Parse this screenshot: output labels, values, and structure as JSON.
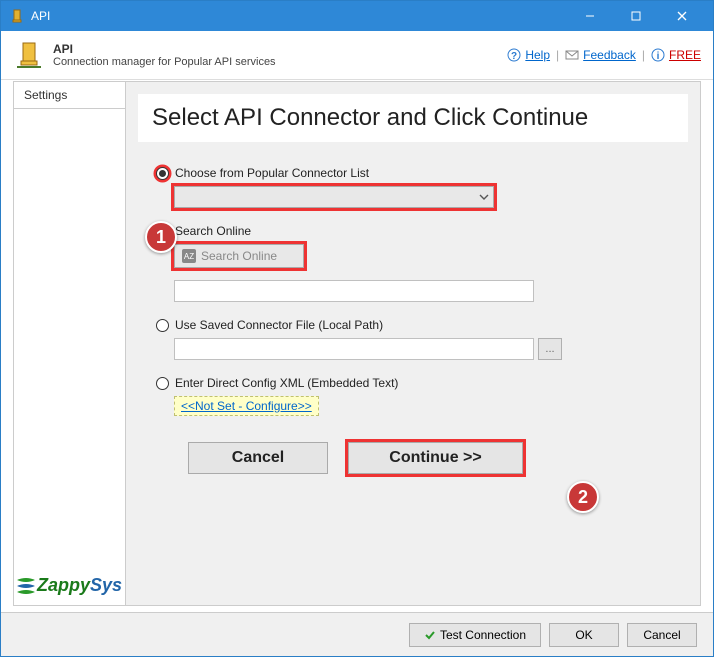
{
  "titlebar": {
    "title": "API"
  },
  "header": {
    "title": "API",
    "subtitle": "Connection manager for Popular API services",
    "links": {
      "help": "Help",
      "feedback": "Feedback",
      "free": "FREE"
    }
  },
  "sidebar": {
    "tab_settings": "Settings"
  },
  "main": {
    "title": "Select API Connector and Click Continue",
    "option_popular": "Choose from Popular Connector List",
    "option_search": "Search Online",
    "search_button_label": "Search Online",
    "option_saved": "Use Saved Connector File (Local Path)",
    "browse_label": "...",
    "option_xml": "Enter Direct Config XML (Embedded Text)",
    "config_link": "<<Not Set - Configure>>",
    "cancel": "Cancel",
    "continue": "Continue >>"
  },
  "footer": {
    "test_connection": "Test Connection",
    "ok": "OK",
    "cancel": "Cancel"
  },
  "callouts": {
    "one": "1",
    "two": "2"
  },
  "logo": {
    "part1": "Zappy",
    "part2": "Sys"
  }
}
